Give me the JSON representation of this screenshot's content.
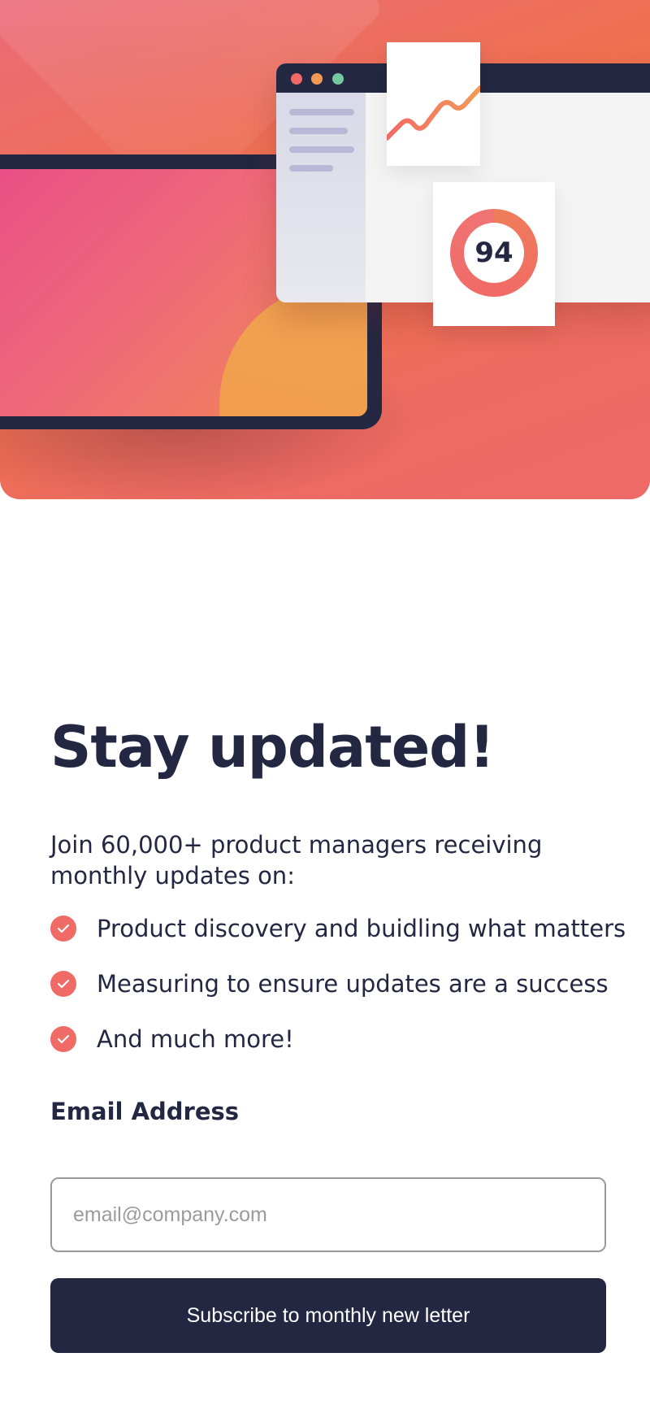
{
  "hero": {
    "score": "94",
    "colors": {
      "coral": "#f06a66",
      "orange": "#ef7d4a",
      "pink": "#ea4f86",
      "navy": "#242742",
      "green_dot": "#74c8a0"
    }
  },
  "main": {
    "title": "Stay updated!",
    "intro": "Join 60,000+ product managers receiving monthly updates on:",
    "features": [
      "Product discovery and buidling what matters",
      "Measuring to ensure updates are a success",
      "And much more!"
    ]
  },
  "form": {
    "email_label": "Email Address",
    "email_value": "",
    "email_placeholder": "email@company.com",
    "submit_label": "Subscribe to monthly new letter"
  },
  "icons": {
    "feature_icon": "check-circle-icon"
  }
}
